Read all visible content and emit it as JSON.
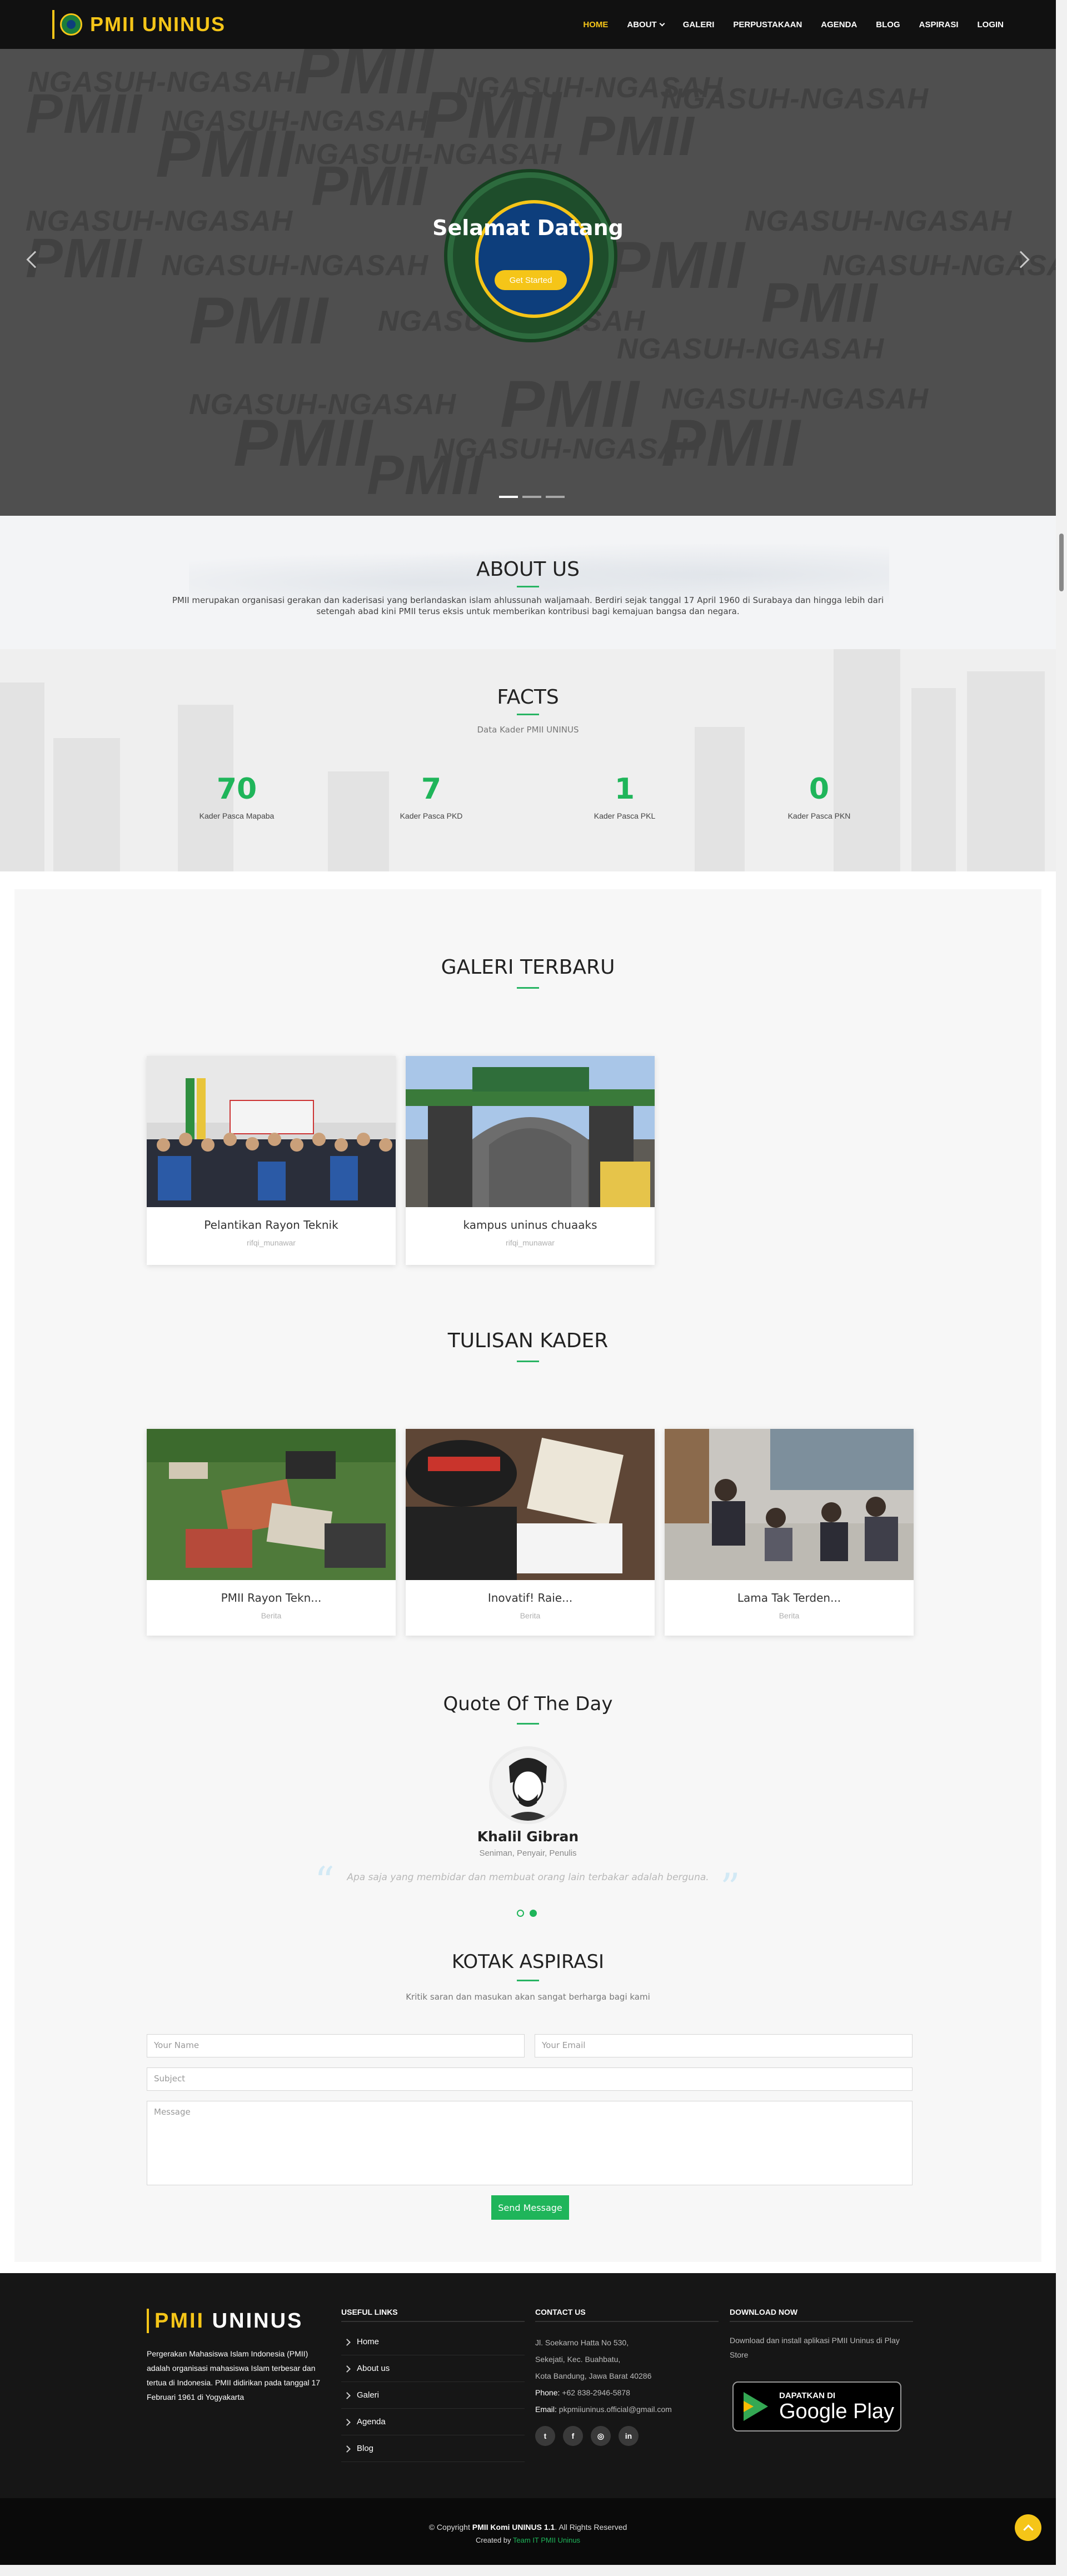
{
  "header": {
    "brand": "PMII UNINUS",
    "nav": [
      "HOME",
      "ABOUT",
      "GALERI",
      "PERPUSTAKAAN",
      "AGENDA",
      "BLOG",
      "ASPIRASI",
      "LOGIN"
    ],
    "active": "HOME"
  },
  "hero": {
    "watermark_word": "PMII",
    "watermark_phrase": "NGASUH-NGASAH",
    "title": "Selamat Datang",
    "button": "Get Started",
    "slides": 3
  },
  "about": {
    "title": "ABOUT US",
    "text": "PMII merupakan organisasi gerakan dan kaderisasi yang berlandaskan islam ahlussunah waljamaah. Berdiri sejak tanggal 17 April 1960 di Surabaya dan hingga lebih dari setengah abad kini PMII terus eksis untuk memberikan kontribusi bagi kemajuan bangsa dan negara."
  },
  "facts": {
    "title": "FACTS",
    "subtitle": "Data Kader PMII UNINUS",
    "items": [
      {
        "value": "70",
        "label": "Kader Pasca Mapaba"
      },
      {
        "value": "7",
        "label": "Kader Pasca PKD"
      },
      {
        "value": "1",
        "label": "Kader Pasca PKL"
      },
      {
        "value": "0",
        "label": "Kader Pasca PKN"
      }
    ]
  },
  "gallery": {
    "title": "GALERI TERBARU",
    "items": [
      {
        "title": "Pelantikan Rayon Teknik",
        "author": "rifqi_munawar"
      },
      {
        "title": "kampus uninus chuaaks",
        "author": "rifqi_munawar"
      }
    ]
  },
  "articles": {
    "title": "TULISAN KADER",
    "items": [
      {
        "title": "PMII Rayon Tekn...",
        "category": "Berita"
      },
      {
        "title": "Inovatif! Raie...",
        "category": "Berita"
      },
      {
        "title": "Lama Tak Terden...",
        "category": "Berita"
      }
    ]
  },
  "quote": {
    "title": "Quote Of The Day",
    "name": "Khalil Gibran",
    "role": "Seniman, Penyair, Penulis",
    "text": "Apa saja yang membidar dan membuat orang lain terbakar adalah berguna.",
    "dots": 2,
    "active_dot": 2
  },
  "aspirasi": {
    "title": "KOTAK ASPIRASI",
    "subtitle": "Kritik saran dan masukan akan sangat berharga bagi kami",
    "name_placeholder": "Your Name",
    "email_placeholder": "Your Email",
    "subject_placeholder": "Subject",
    "message_placeholder": "Message",
    "submit": "Send Message"
  },
  "footer": {
    "brand_a": "PMII",
    "brand_b": " UNINUS",
    "about": "Pergerakan Mahasiswa Islam Indonesia (PMII) adalah organisasi mahasiswa Islam terbesar dan tertua di Indonesia. PMII didirikan pada tanggal 17 Februari 1961 di Yogyakarta",
    "links_title": "USEFUL LINKS",
    "links": [
      "Home",
      "About us",
      "Galeri",
      "Agenda",
      "Blog"
    ],
    "contact_title": "CONTACT US",
    "address1": "Jl. Soekarno Hatta No 530,",
    "address2": "Sekejati, Kec. Buahbatu,",
    "address3": "Kota Bandung, Jawa Barat 40286",
    "phone_label": "Phone:",
    "phone": "+62 838-2946-5878",
    "email_label": "Email:",
    "email": "pkpmiiuninus.official@gmail.com",
    "socials": [
      "twitter-icon",
      "facebook-icon",
      "instagram-icon",
      "linkedin-icon"
    ],
    "download_title": "DOWNLOAD NOW",
    "download_text": "Download dan install aplikasi PMII Uninus di Play Store",
    "gplay_small": "DAPATKAN DI",
    "gplay_big": "Google Play"
  },
  "bottom": {
    "copy_pre": "© Copyright",
    "copy_brand": "PMII Komi UNINUS 1.1",
    "copy_post": ". All Rights Reserved",
    "credit_pre": "Created by",
    "credit_team": "Team IT PMII Uninus"
  }
}
